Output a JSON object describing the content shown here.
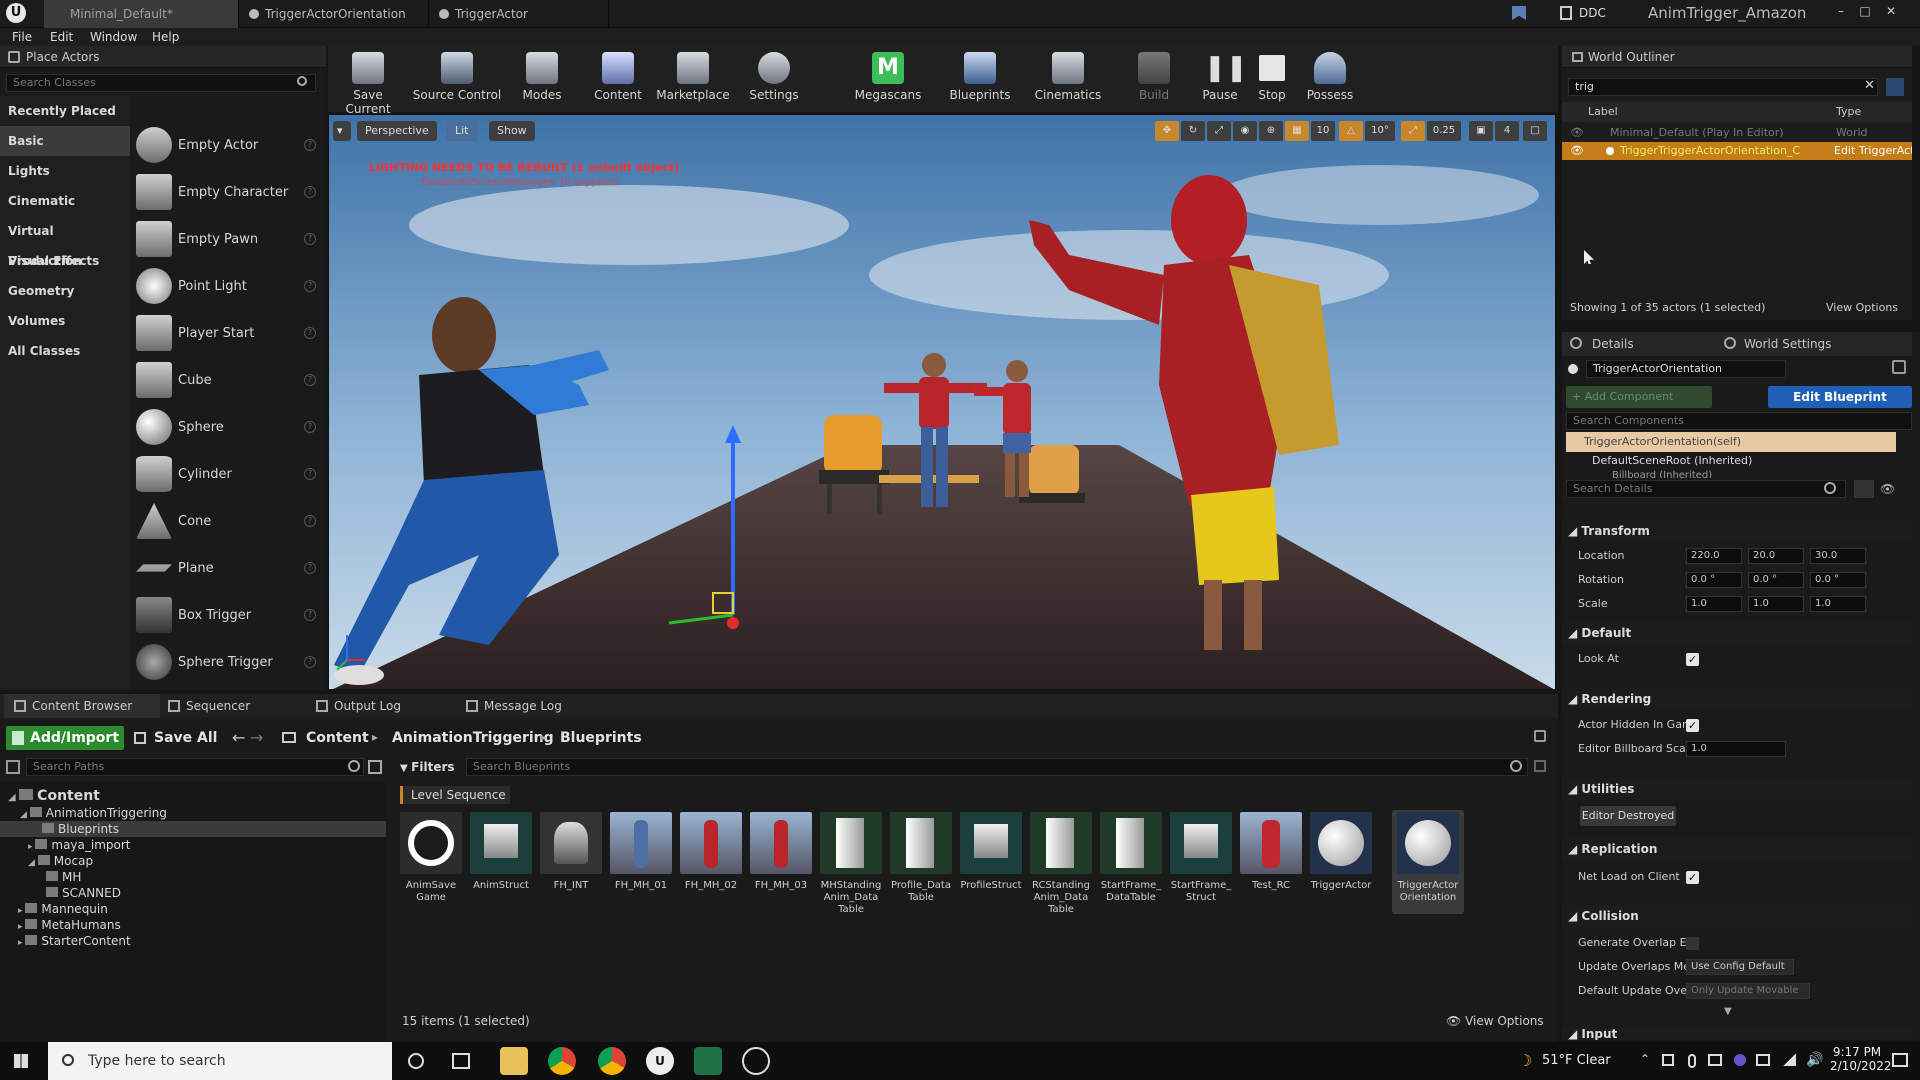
{
  "window": {
    "tabs": [
      "Minimal_Default*",
      "TriggerActorOrientation",
      "TriggerActor"
    ],
    "ddc": "DDC",
    "project": "AnimTrigger_Amazon"
  },
  "menu": [
    "File",
    "Edit",
    "Window",
    "Help"
  ],
  "place_actors": {
    "title": "Place Actors",
    "search_placeholder": "Search Classes",
    "categories": [
      "Recently Placed",
      "Basic",
      "Lights",
      "Cinematic",
      "Virtual Production",
      "Visual Effects",
      "Geometry",
      "Volumes",
      "All Classes"
    ],
    "items": [
      "Empty Actor",
      "Empty Character",
      "Empty Pawn",
      "Point Light",
      "Player Start",
      "Cube",
      "Sphere",
      "Cylinder",
      "Cone",
      "Plane",
      "Box Trigger",
      "Sphere Trigger"
    ]
  },
  "toolbar": [
    "Save Current",
    "Source Control",
    "Modes",
    "Content",
    "Marketplace",
    "Settings",
    "Megascans",
    "Blueprints",
    "Cinematics",
    "Build",
    "Pause",
    "Stop",
    "Possess"
  ],
  "viewport": {
    "perspective": "Perspective",
    "lit": "Lit",
    "show": "Show",
    "warning": "LIGHTING NEEDS TO BE REBUILT (1 unbuilt object)",
    "warning_sub": "'DisableAllScreenMessages' to suppress",
    "grid": "10",
    "angle": "10°",
    "scale": "0.25",
    "cam": "4"
  },
  "outliner": {
    "title": "World Outliner",
    "search": "trig",
    "col_label": "Label",
    "col_type": "Type",
    "rows": [
      {
        "label": "Minimal_Default (Play In Editor)",
        "type": "World"
      },
      {
        "label": "TriggerTriggerActorOrientation_C",
        "type": "Edit TriggerActo"
      }
    ],
    "status": "Showing 1 of 35 actors (1 selected)",
    "view_options": "View Options"
  },
  "details": {
    "tab": "Details",
    "tab2": "World Settings",
    "actor_name": "TriggerActorOrientation",
    "add_component": "+ Add Component",
    "edit_blueprint": "Edit Blueprint",
    "search_components": "Search Components",
    "comp_self": "TriggerActorOrientation(self)",
    "comp_root": "DefaultSceneRoot (Inherited)",
    "comp_billboard": "Billboard (Inherited)",
    "search_details": "Search Details",
    "transform": "Transform",
    "location_label": "Location",
    "location": [
      "220.0",
      "20.0",
      "30.0"
    ],
    "rotation_label": "Rotation",
    "rotation": [
      "0.0 °",
      "0.0 °",
      "0.0 °"
    ],
    "scale_label": "Scale",
    "scale": [
      "1.0",
      "1.0",
      "1.0"
    ],
    "default": "Default",
    "look_at": "Look At",
    "rendering": "Rendering",
    "actor_hidden": "Actor Hidden In Gam",
    "billboard_scale_label": "Editor Billboard Scal",
    "billboard_scale": "1.0",
    "utilities": "Utilities",
    "editor_destroyed": "Editor Destroyed",
    "replication": "Replication",
    "net_load": "Net Load on Client",
    "collision": "Collision",
    "gen_overlap": "Generate Overlap Ev",
    "update_overlaps": "Update Overlaps Me",
    "update_overlaps_val": "Use Config Default",
    "default_update": "Default Update Over",
    "default_update_val": "Only Update Movable",
    "input": "Input"
  },
  "bottom_tabs": [
    "Content Browser",
    "Sequencer",
    "Output Log",
    "Message Log"
  ],
  "content_browser": {
    "add_import": "Add/Import",
    "save_all": "Save All",
    "path": [
      "Content",
      "AnimationTriggering",
      "Blueprints"
    ],
    "search_paths": "Search Paths",
    "filters": "Filters",
    "search_bp": "Search Blueprints",
    "filter_tag": "Level Sequence",
    "tree": [
      {
        "label": "Content",
        "indent": 0
      },
      {
        "label": "AnimationTriggering",
        "indent": 1
      },
      {
        "label": "Blueprints",
        "indent": 2
      },
      {
        "label": "maya_import",
        "indent": 2
      },
      {
        "label": "Mocap",
        "indent": 2
      },
      {
        "label": "MH",
        "indent": 3
      },
      {
        "label": "SCANNED",
        "indent": 3
      },
      {
        "label": "Mannequin",
        "indent": 1
      },
      {
        "label": "MetaHumans",
        "indent": 1
      },
      {
        "label": "StarterContent",
        "indent": 1
      }
    ],
    "assets": [
      "AnimSave Game",
      "AnimStruct",
      "FH_INT",
      "FH_MH_01",
      "FH_MH_02",
      "FH_MH_03",
      "MHStanding Anim_Data Table",
      "Profile_Data Table",
      "ProfileStruct",
      "RCStanding Anim_Data Table",
      "StartFrame_ DataTable",
      "StartFrame_ Struct",
      "Test_RC",
      "TriggerActor",
      "TriggerActor Orientation"
    ],
    "count": "15 items (1 selected)",
    "view_options": "View Options"
  },
  "taskbar": {
    "search": "Type here to search",
    "weather": "51°F Clear",
    "time": "9:17 PM",
    "date": "2/10/2022"
  }
}
